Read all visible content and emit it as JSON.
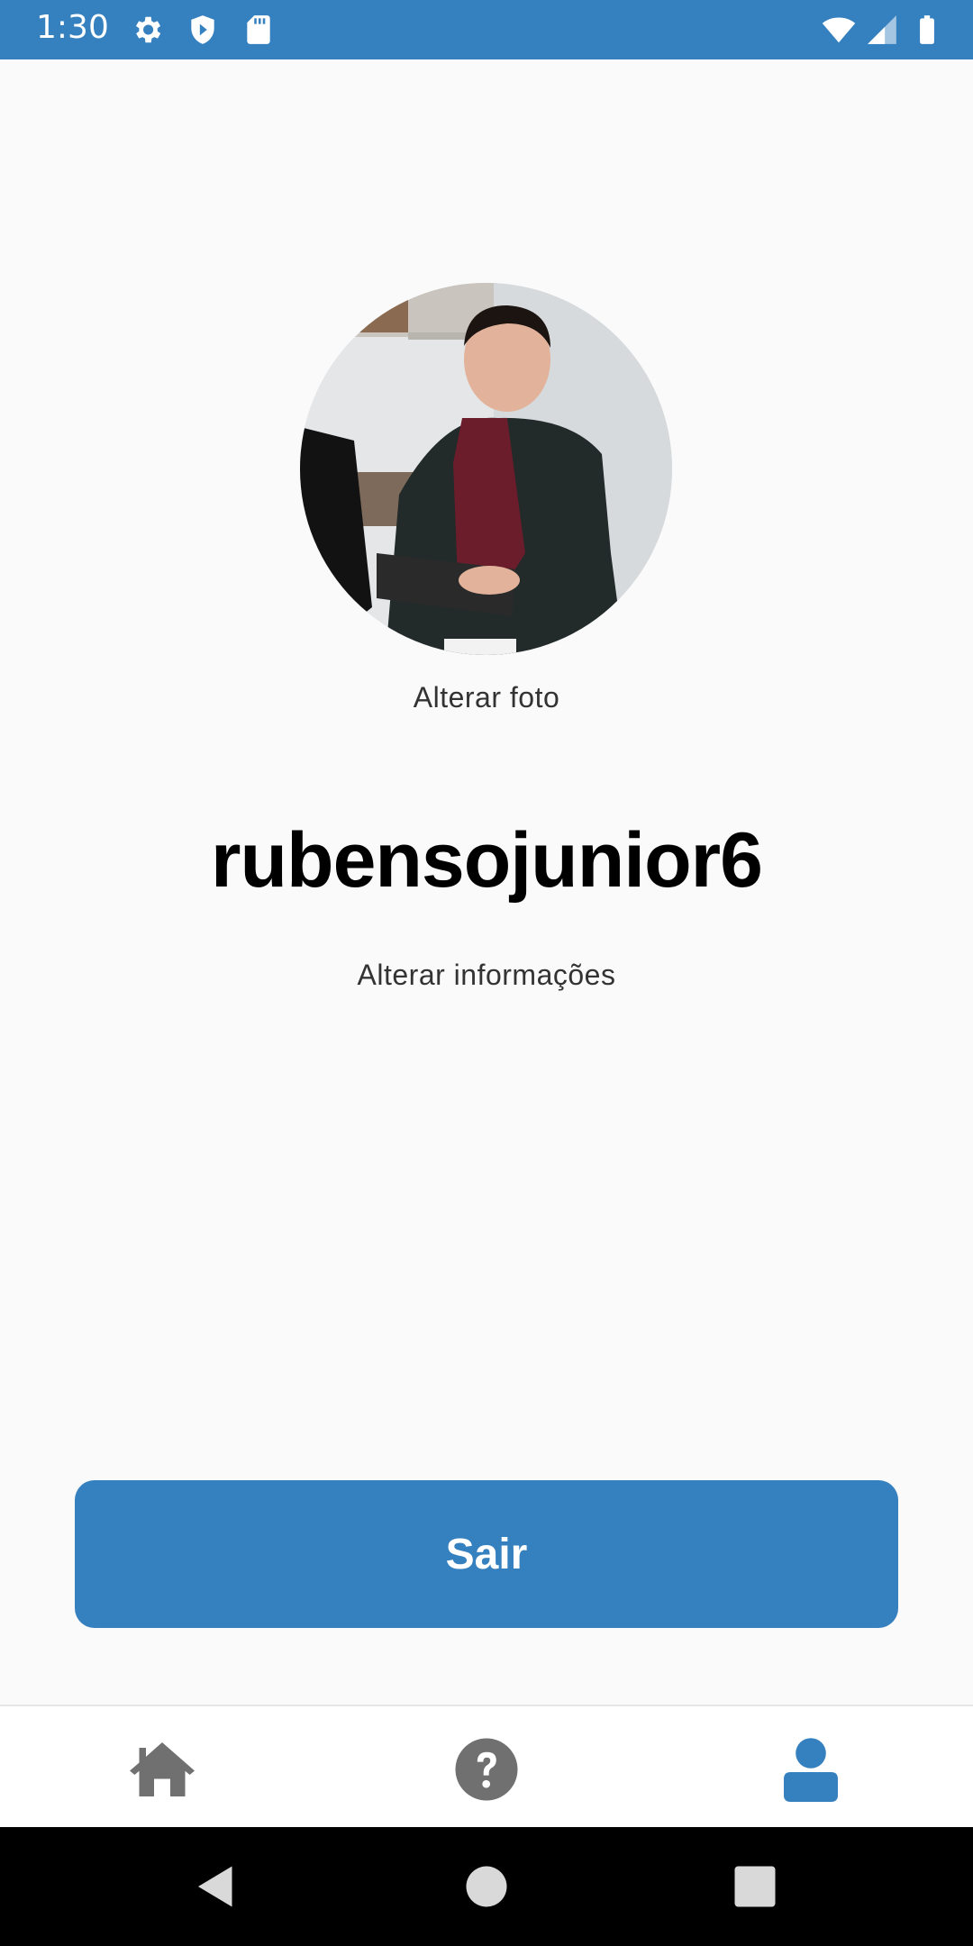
{
  "status_bar": {
    "time": "1:30",
    "icons": [
      "gear-icon",
      "shield-icon",
      "sd-card-icon",
      "wifi-icon",
      "signal-icon",
      "battery-icon"
    ]
  },
  "profile": {
    "change_photo_label": "Alterar foto",
    "username": "rubensojunior6",
    "change_info_label": "Alterar informações"
  },
  "actions": {
    "logout_label": "Sair"
  },
  "bottom_nav": {
    "items": [
      {
        "icon": "home-icon",
        "active": false
      },
      {
        "icon": "help-icon",
        "active": false
      },
      {
        "icon": "user-icon",
        "active": true
      }
    ]
  },
  "system_nav": {
    "buttons": [
      "back-icon",
      "home-circle-icon",
      "recents-icon"
    ]
  },
  "colors": {
    "accent": "#3580bf",
    "inactive_icon": "#707070",
    "background": "#fafafa"
  }
}
